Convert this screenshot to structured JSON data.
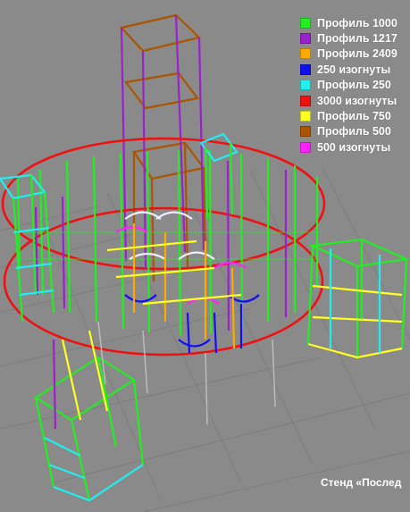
{
  "legend": {
    "items": [
      {
        "label": "Профиль 1000",
        "color": "#22ee22"
      },
      {
        "label": "Профиль 1217",
        "color": "#9922cc"
      },
      {
        "label": "Профиль 2409",
        "color": "#ffaa00"
      },
      {
        "label": "250 изогнуты",
        "color": "#1111ee"
      },
      {
        "label": "Профиль 250",
        "color": "#22eeee"
      },
      {
        "label": "3000 изогнуты",
        "color": "#ee1111"
      },
      {
        "label": "Профиль 750",
        "color": "#ffff22"
      },
      {
        "label": "Профиль 500",
        "color": "#aa5500"
      },
      {
        "label": "500 изогнуты",
        "color": "#ff22ff"
      }
    ]
  },
  "caption": "Стенд «Послед"
}
